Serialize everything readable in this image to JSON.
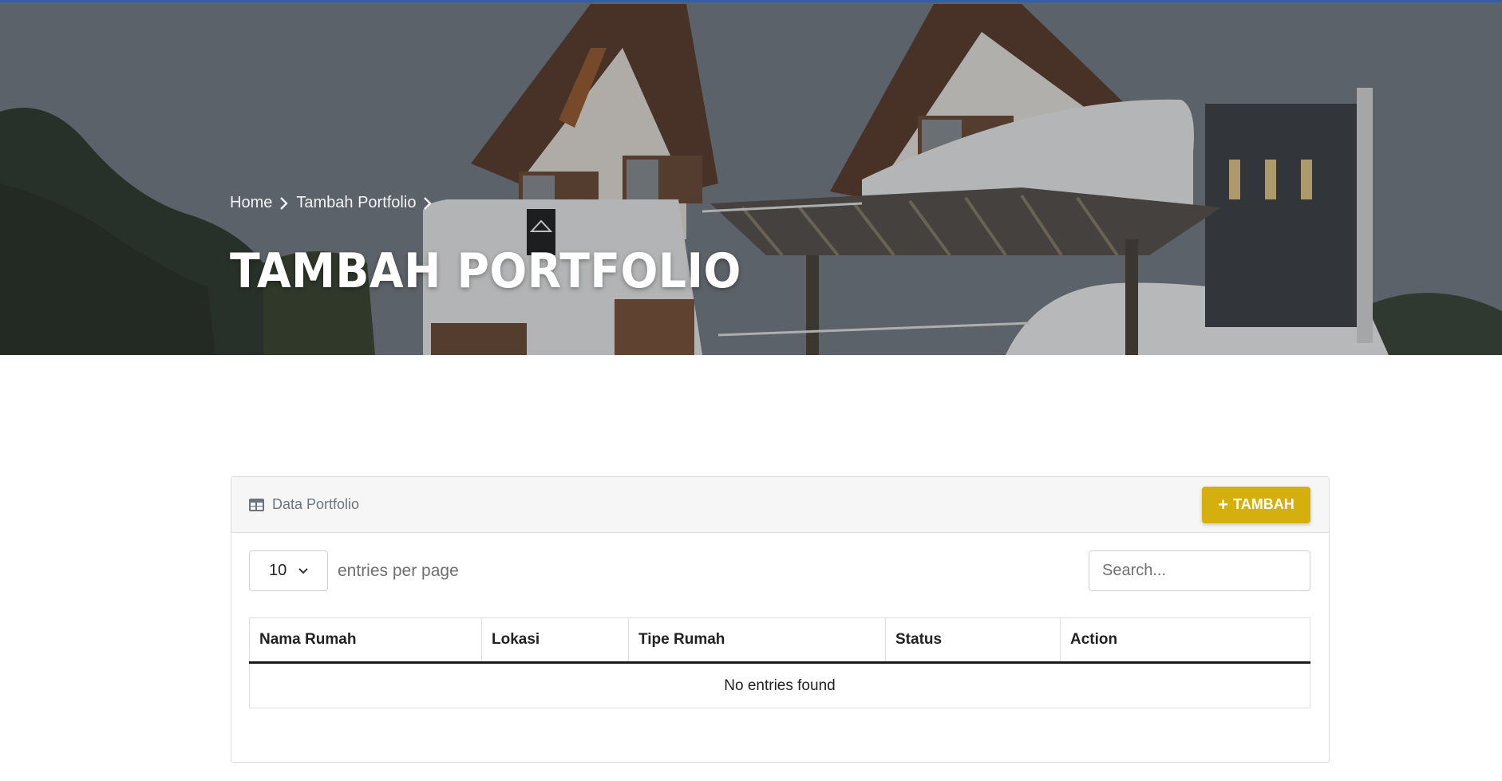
{
  "hero": {
    "breadcrumb": [
      "Home",
      "Tambah Portfolio"
    ],
    "title": "TAMBAH PORTFOLIO"
  },
  "card": {
    "title": "Data Portfolio",
    "add_button": "TAMBAH",
    "per_page_value": "10",
    "per_page_label": "entries per page",
    "search_placeholder": "Search...",
    "columns": [
      "Nama Rumah",
      "Lokasi",
      "Tipe Rumah",
      "Status",
      "Action"
    ],
    "empty_message": "No entries found"
  },
  "colors": {
    "accent": "#d4af0e",
    "topline": "#2f5fa8"
  },
  "icons": {
    "breadcrumb_separator": "chevron-right-icon",
    "card_title": "table-icon",
    "add_button": "plus-icon",
    "select": "chevron-down-icon"
  }
}
